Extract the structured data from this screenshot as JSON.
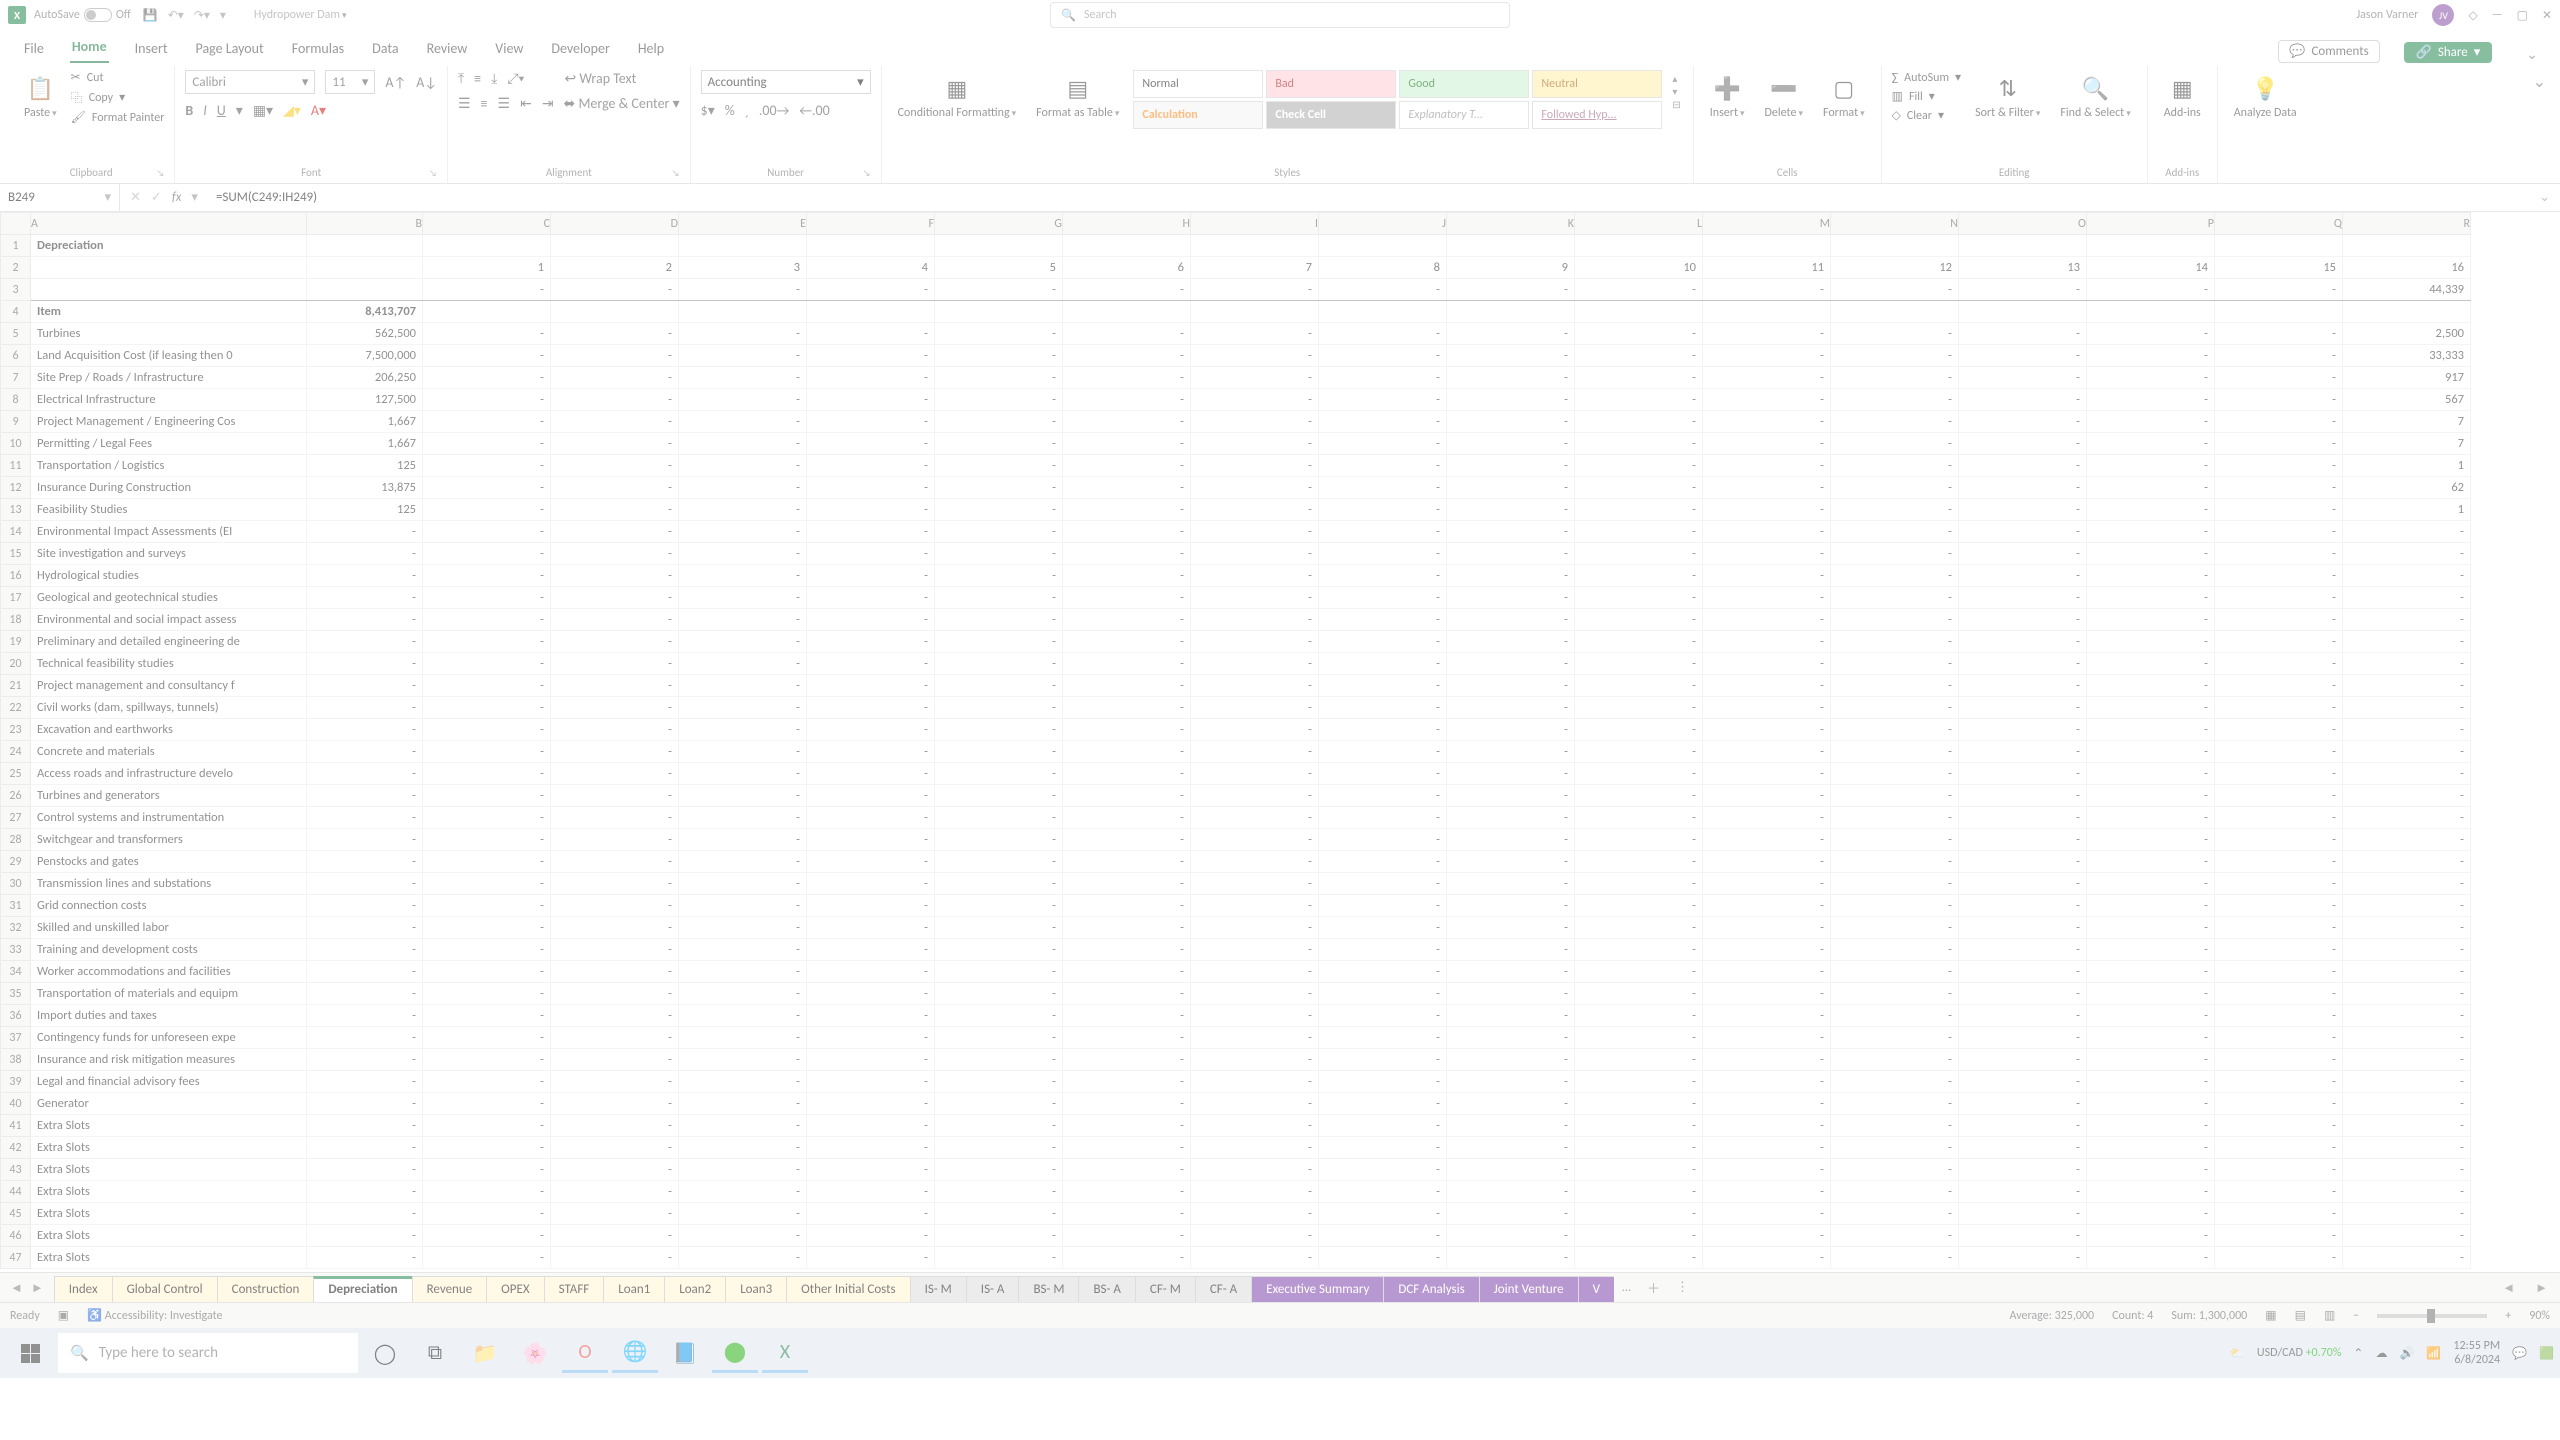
{
  "titlebar": {
    "autosave_label": "AutoSave",
    "autosave_state": "Off",
    "doc_name": "Hydropower Dam",
    "search_placeholder": "Search",
    "user_name": "Jason Varner",
    "user_initials": "JV"
  },
  "menu": {
    "tabs": [
      "File",
      "Home",
      "Insert",
      "Page Layout",
      "Formulas",
      "Data",
      "Review",
      "View",
      "Developer",
      "Help"
    ],
    "active": "Home",
    "comments": "Comments",
    "share": "Share"
  },
  "ribbon": {
    "clipboard": {
      "paste": "Paste",
      "cut": "Cut",
      "copy": "Copy",
      "format_painter": "Format Painter",
      "label": "Clipboard"
    },
    "font": {
      "name": "Calibri",
      "size": "11",
      "label": "Font"
    },
    "alignment": {
      "wrap": "Wrap Text",
      "merge": "Merge & Center",
      "label": "Alignment"
    },
    "number": {
      "format": "Accounting",
      "label": "Number"
    },
    "styles": {
      "cond": "Conditional Formatting",
      "table": "Format as Table",
      "cells": [
        "Normal",
        "Bad",
        "Good",
        "Neutral",
        "Calculation",
        "Check Cell",
        "Explanatory T...",
        "Followed Hyp..."
      ],
      "label": "Styles"
    },
    "cells": {
      "insert": "Insert",
      "delete": "Delete",
      "format": "Format",
      "label": "Cells"
    },
    "editing": {
      "autosum": "AutoSum",
      "fill": "Fill",
      "clear": "Clear",
      "sort": "Sort & Filter",
      "find": "Find & Select",
      "label": "Editing"
    },
    "addins": {
      "addins": "Add-ins",
      "label": "Add-ins"
    },
    "analyze": {
      "btn": "Analyze Data"
    }
  },
  "formula_bar": {
    "cell_ref": "B249",
    "formula": "=SUM(C249:IH249)"
  },
  "columns": [
    "A",
    "B",
    "C",
    "D",
    "E",
    "F",
    "G",
    "H",
    "I",
    "J",
    "K",
    "L",
    "M",
    "N",
    "O",
    "P",
    "Q",
    "R"
  ],
  "col_year_headers": [
    "",
    "",
    "1",
    "2",
    "3",
    "4",
    "5",
    "6",
    "7",
    "8",
    "9",
    "10",
    "11",
    "12",
    "13",
    "14",
    "15",
    "16"
  ],
  "row3": [
    "",
    "",
    "-",
    "-",
    "-",
    "-",
    "-",
    "-",
    "-",
    "-",
    "-",
    "-",
    "-",
    "-",
    "-",
    "-",
    "-",
    "44,339"
  ],
  "rows": [
    {
      "n": 1,
      "a": "Depreciation",
      "b": ""
    },
    {
      "n": 2,
      "a": "",
      "b": ""
    },
    {
      "n": 3,
      "a": "",
      "b": ""
    },
    {
      "n": 4,
      "a": "Item",
      "b": "8,413,707"
    },
    {
      "n": 5,
      "a": "Turbines",
      "b": "562,500",
      "r": "2,500"
    },
    {
      "n": 6,
      "a": "Land Acquisition Cost (if leasing then 0",
      "b": "7,500,000",
      "r": "33,333"
    },
    {
      "n": 7,
      "a": "Site Prep / Roads / Infrastructure",
      "b": "206,250",
      "r": "917"
    },
    {
      "n": 8,
      "a": "Electrical Infrastructure",
      "b": "127,500",
      "r": "567"
    },
    {
      "n": 9,
      "a": "Project Management / Engineering Cos",
      "b": "1,667",
      "r": "7"
    },
    {
      "n": 10,
      "a": "Permitting / Legal Fees",
      "b": "1,667",
      "r": "7"
    },
    {
      "n": 11,
      "a": "Transportation / Logistics",
      "b": "125",
      "r": "1"
    },
    {
      "n": 12,
      "a": "Insurance During Construction",
      "b": "13,875",
      "r": "62"
    },
    {
      "n": 13,
      "a": "Feasibility Studies",
      "b": "125",
      "r": "1"
    },
    {
      "n": 14,
      "a": "Environmental Impact Assessments (EI",
      "b": "-",
      "r": "-"
    },
    {
      "n": 15,
      "a": "Site investigation and surveys",
      "b": "-",
      "r": "-"
    },
    {
      "n": 16,
      "a": "Hydrological studies",
      "b": "-",
      "r": "-"
    },
    {
      "n": 17,
      "a": "Geological and geotechnical studies",
      "b": "-",
      "r": "-"
    },
    {
      "n": 18,
      "a": "Environmental and social impact assess",
      "b": "-",
      "r": "-"
    },
    {
      "n": 19,
      "a": "Preliminary and detailed engineering de",
      "b": "-",
      "r": "-"
    },
    {
      "n": 20,
      "a": "Technical feasibility studies",
      "b": "-",
      "r": "-"
    },
    {
      "n": 21,
      "a": "Project management and consultancy f",
      "b": "-",
      "r": "-"
    },
    {
      "n": 22,
      "a": "Civil works (dam, spillways, tunnels)",
      "b": "-",
      "r": "-"
    },
    {
      "n": 23,
      "a": "Excavation and earthworks",
      "b": "-",
      "r": "-"
    },
    {
      "n": 24,
      "a": "Concrete and materials",
      "b": "-",
      "r": "-"
    },
    {
      "n": 25,
      "a": "Access roads and infrastructure develo",
      "b": "-",
      "r": "-"
    },
    {
      "n": 26,
      "a": "Turbines and generators",
      "b": "-",
      "r": "-"
    },
    {
      "n": 27,
      "a": "Control systems and instrumentation",
      "b": "-",
      "r": "-"
    },
    {
      "n": 28,
      "a": "Switchgear and transformers",
      "b": "-",
      "r": "-"
    },
    {
      "n": 29,
      "a": "Penstocks and gates",
      "b": "-",
      "r": "-"
    },
    {
      "n": 30,
      "a": "Transmission lines and substations",
      "b": "-",
      "r": "-"
    },
    {
      "n": 31,
      "a": "Grid connection costs",
      "b": "-",
      "r": "-"
    },
    {
      "n": 32,
      "a": "Skilled and unskilled labor",
      "b": "-",
      "r": "-"
    },
    {
      "n": 33,
      "a": "Training and development costs",
      "b": "-",
      "r": "-"
    },
    {
      "n": 34,
      "a": "Worker accommodations and facilities",
      "b": "-",
      "r": "-"
    },
    {
      "n": 35,
      "a": "Transportation of materials and equipm",
      "b": "-",
      "r": "-"
    },
    {
      "n": 36,
      "a": "Import duties and taxes",
      "b": "-",
      "r": "-"
    },
    {
      "n": 37,
      "a": "Contingency funds for unforeseen expe",
      "b": "-",
      "r": "-"
    },
    {
      "n": 38,
      "a": "Insurance and risk mitigation measures",
      "b": "-",
      "r": "-"
    },
    {
      "n": 39,
      "a": "Legal and financial advisory fees",
      "b": "-",
      "r": "-"
    },
    {
      "n": 40,
      "a": "Generator",
      "b": "-",
      "r": "-"
    },
    {
      "n": 41,
      "a": "Extra Slots",
      "b": "-",
      "r": "-"
    },
    {
      "n": 42,
      "a": "Extra Slots",
      "b": "-",
      "r": "-"
    },
    {
      "n": 43,
      "a": "Extra Slots",
      "b": "-",
      "r": "-"
    },
    {
      "n": 44,
      "a": "Extra Slots",
      "b": "-",
      "r": "-"
    },
    {
      "n": 45,
      "a": "Extra Slots",
      "b": "-",
      "r": "-"
    },
    {
      "n": 46,
      "a": "Extra Slots",
      "b": "-",
      "r": "-"
    },
    {
      "n": 47,
      "a": "Extra Slots",
      "b": "-",
      "r": "-"
    }
  ],
  "sheet_tabs": [
    {
      "name": "Index",
      "c": "c-yel"
    },
    {
      "name": "Global Control",
      "c": "c-yel"
    },
    {
      "name": "Construction",
      "c": "c-yel"
    },
    {
      "name": "Depreciation",
      "c": "active"
    },
    {
      "name": "Revenue",
      "c": "c-yel"
    },
    {
      "name": "OPEX",
      "c": "c-yel"
    },
    {
      "name": "STAFF",
      "c": "c-yel"
    },
    {
      "name": "Loan1",
      "c": "c-yel"
    },
    {
      "name": "Loan2",
      "c": "c-yel"
    },
    {
      "name": "Loan3",
      "c": "c-yel"
    },
    {
      "name": "Other Initial Costs",
      "c": "c-yel"
    },
    {
      "name": "IS- M",
      "c": "c-gry"
    },
    {
      "name": "IS- A",
      "c": "c-gry"
    },
    {
      "name": "BS- M",
      "c": "c-gry"
    },
    {
      "name": "BS- A",
      "c": "c-gry"
    },
    {
      "name": "CF- M",
      "c": "c-gry"
    },
    {
      "name": "CF- A",
      "c": "c-gry"
    },
    {
      "name": "Executive Summary",
      "c": "c-pur"
    },
    {
      "name": "DCF Analysis",
      "c": "c-pur"
    },
    {
      "name": "Joint Venture",
      "c": "c-pur"
    },
    {
      "name": "V",
      "c": "c-pur"
    }
  ],
  "status": {
    "ready": "Ready",
    "access": "Accessibility: Investigate",
    "average": "Average: 325,000",
    "count": "Count: 4",
    "sum": "Sum: 1,300,000",
    "zoom": "90%"
  },
  "taskbar": {
    "search_placeholder": "Type here to search",
    "ticker": "USD/CAD",
    "ticker_change": "+0.70%",
    "time": "12:55 PM",
    "date": "6/8/2024"
  }
}
